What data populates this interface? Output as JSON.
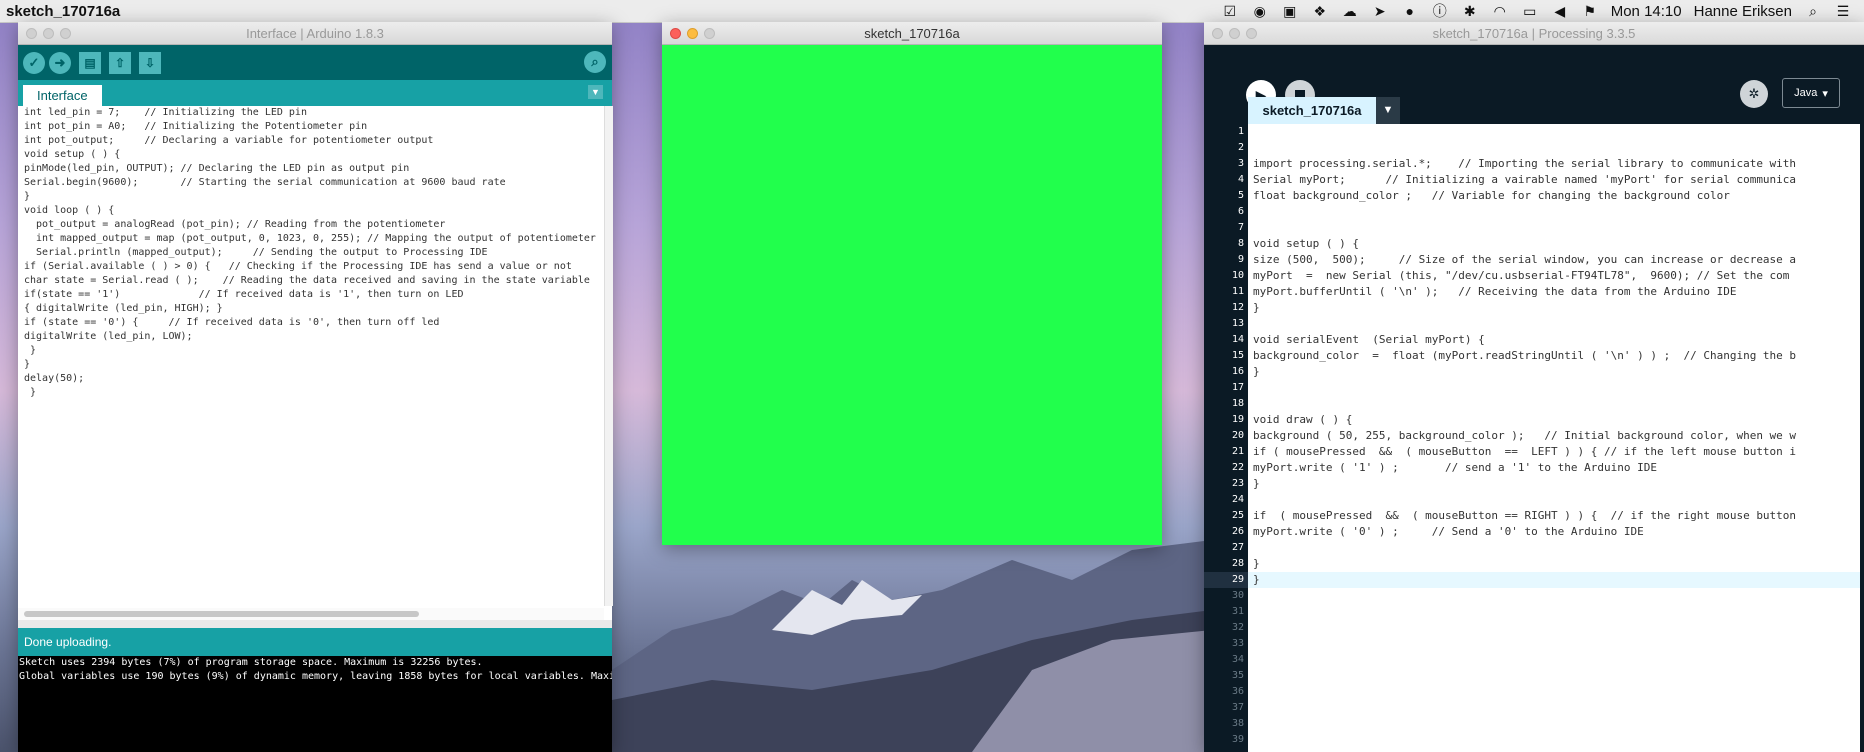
{
  "menubar": {
    "app_name": "sketch_170716a",
    "clock": "Mon 14:10",
    "user": "Hanne Eriksen",
    "icons": [
      "check-icon",
      "camera-icon",
      "calendar-icon",
      "dropbox-icon",
      "cloud-icon",
      "location-arrow-icon",
      "record-icon",
      "info-icon",
      "bluetooth-icon",
      "wifi-icon",
      "airplay-icon",
      "volume-icon",
      "flag-icon",
      "search-icon",
      "menu-icon"
    ]
  },
  "arduino": {
    "title": "Interface | Arduino 1.8.3",
    "tab": "Interface",
    "status": "Done uploading.",
    "console": [
      "Sketch uses 2394 bytes (7%) of program storage space. Maximum is 32256 bytes.",
      "Global variables use 190 bytes (9%) of dynamic memory, leaving 1858 bytes for local variables. Maxi"
    ],
    "code": [
      "int led_pin = 7;    // Initializing the LED pin",
      "int pot_pin = A0;   // Initializing the Potentiometer pin",
      "int pot_output;     // Declaring a variable for potentiometer output",
      "",
      "void setup ( ) {",
      "pinMode(led_pin, OUTPUT); // Declaring the LED pin as output pin",
      "Serial.begin(9600);       // Starting the serial communication at 9600 baud rate",
      "}",
      "",
      "void loop ( ) {",
      "  pot_output = analogRead (pot_pin); // Reading from the potentiometer",
      "  int mapped_output = map (pot_output, 0, 1023, 0, 255); // Mapping the output of potentiometer",
      "  Serial.println (mapped_output);     // Sending the output to Processing IDE",
      "",
      "if (Serial.available ( ) > 0) {   // Checking if the Processing IDE has send a value or not",
      "char state = Serial.read ( );    // Reading the data received and saving in the state variable",
      "if(state == '1')             // If received data is '1', then turn on LED",
      "",
      "{ digitalWrite (led_pin, HIGH); }",
      "if (state == '0') {     // If received data is '0', then turn off led",
      "digitalWrite (led_pin, LOW);",
      "",
      " }",
      "}",
      "",
      "delay(50);",
      "",
      " }"
    ]
  },
  "sketch_window": {
    "title": "sketch_170716a",
    "background_color": "#21ff4c"
  },
  "processing": {
    "title": "sketch_170716a | Processing 3.3.5",
    "tab": "sketch_170716a",
    "mode": "Java",
    "current_line": 29,
    "line_count": 39,
    "code": [
      "",
      "",
      "import processing.serial.*;    // Importing the serial library to communicate with",
      "Serial myPort;      // Initializing a vairable named 'myPort' for serial communica",
      "float background_color ;   // Variable for changing the background color",
      "",
      "",
      "void setup ( ) {",
      "size (500,  500);     // Size of the serial window, you can increase or decrease a",
      "myPort  =  new Serial (this, \"/dev/cu.usbserial-FT94TL78\",  9600); // Set the com",
      "myPort.bufferUntil ( '\\n' );   // Receiving the data from the Arduino IDE",
      "}",
      "",
      "void serialEvent  (Serial myPort) {",
      "background_color  =  float (myPort.readStringUntil ( '\\n' ) ) ;  // Changing the b",
      "}",
      "",
      "",
      "void draw ( ) {",
      "background ( 50, 255, background_color );   // Initial background color, when we w",
      "if ( mousePressed  &&  ( mouseButton  ==  LEFT ) ) { // if the left mouse button i",
      "myPort.write ( '1' ) ;       // send a '1' to the Arduino IDE",
      "}",
      "",
      "if  ( mousePressed  &&  ( mouseButton == RIGHT ) ) {  // if the right mouse button",
      "myPort.write ( '0' ) ;     // Send a '0' to the Arduino IDE",
      "",
      "}",
      "}"
    ]
  }
}
